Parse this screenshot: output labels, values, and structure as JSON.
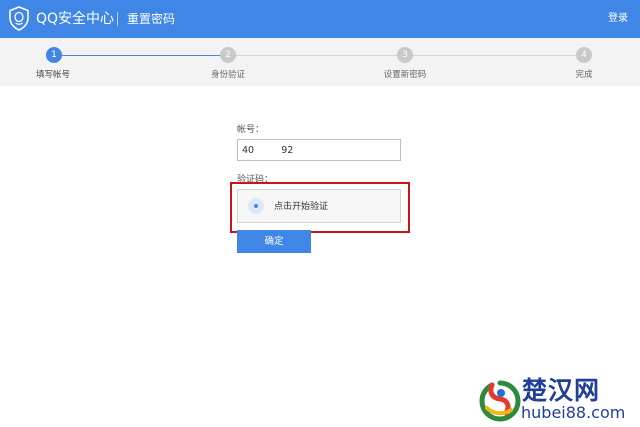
{
  "header": {
    "brand": "QQ安全中心",
    "subtitle": "重置密码",
    "login": "登录"
  },
  "steps": [
    {
      "number": "1",
      "label": "填写帐号",
      "active": true
    },
    {
      "number": "2",
      "label": "身份验证",
      "active": false
    },
    {
      "number": "3",
      "label": "设置新密码",
      "active": false
    },
    {
      "number": "4",
      "label": "完成",
      "active": false
    }
  ],
  "form": {
    "account_label": "帐号：",
    "account_value": "40         92",
    "captcha_label": "验证码：",
    "captcha_button": "点击开始验证",
    "confirm": "确定"
  },
  "watermark": {
    "title": "楚汉网",
    "domain": "hubei88.com"
  },
  "colors": {
    "accent": "#3f86e6",
    "highlight": "#c8151b",
    "step_inactive": "#c9c9c9",
    "watermark": "#1f3f9a"
  }
}
